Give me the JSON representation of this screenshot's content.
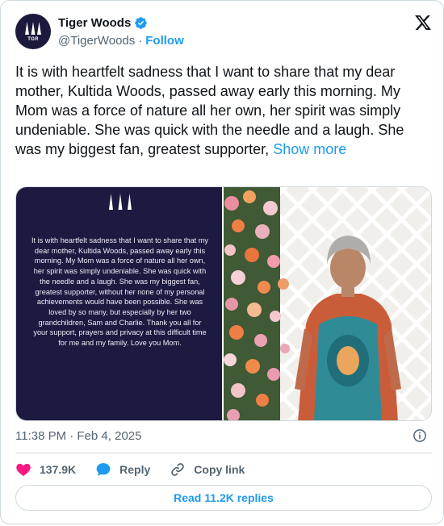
{
  "author": {
    "name": "Tiger Woods",
    "handle": "@TigerWoods",
    "separator": "·",
    "follow_label": "Follow",
    "avatar_text": "TGR"
  },
  "tweet": {
    "text": "It is with heartfelt sadness that I want to share that my dear mother, Kultida Woods, passed away early this morning. My Mom was a force of nature all her own, her spirit was simply undeniable. She was quick with the needle and a laugh. She was my biggest fan, greatest supporter,",
    "show_more_label": "Show more"
  },
  "media": {
    "statement_text": "It is with heartfelt sadness that I want to share that my dear mother, Kultida Woods, passed away early this morning. My Mom was a force of nature all her own, her spirit was simply undeniable. She was quick with the needle and a laugh. She was my biggest fan, greatest supporter, without her none of my personal achievements would have been possible. She was loved by so many, but especially by her two grandchildren, Sam and Charlie. Thank you all for your support, prayers and privacy at this difficult time for me and my family. Love you Mom."
  },
  "meta": {
    "timestamp": "11:38 PM · Feb 4, 2025"
  },
  "actions": {
    "like_count": "137.9K",
    "reply_label": "Reply",
    "copy_link_label": "Copy link"
  },
  "read_replies_label": "Read 11.2K replies",
  "colors": {
    "accent": "#1d9bf0",
    "like": "#f91880",
    "text": "#0f1419",
    "secondary": "#536471",
    "border": "#cfd9de"
  }
}
